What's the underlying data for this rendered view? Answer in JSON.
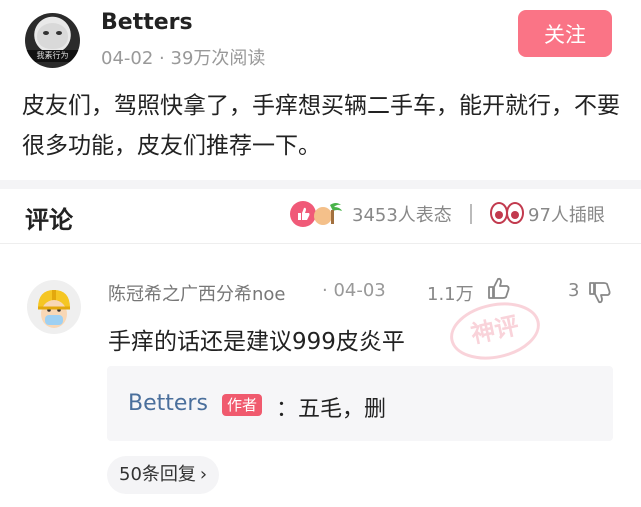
{
  "post": {
    "author": "Betters",
    "date": "04-02",
    "meta_sep": "·",
    "views": "39万次阅读",
    "follow_label": "关注",
    "text": "皮友们，驾照快拿了，手痒想买辆二手车，能开就行，不要很多功能，皮友们推荐一下。",
    "avatar_strip": "我素行为"
  },
  "comments_header": {
    "title": "评论",
    "reactions": "3453人表态",
    "watchers": "97人插眼"
  },
  "comment": {
    "name": "陈冠希之广西分希noe",
    "date": "· 04-03",
    "likes": "1.1万",
    "dislikes": "3",
    "text": "手痒的话还是建议999皮炎平",
    "stamp": "神评",
    "reply": {
      "author": "Betters",
      "tag": "作者",
      "text": "：五毛，删"
    },
    "more_replies": "50条回复",
    "more_arrow": "›"
  },
  "colors": {
    "accent": "#fa7486",
    "reply_author": "#4a6f9c",
    "stamp": "#f3a0ae"
  }
}
